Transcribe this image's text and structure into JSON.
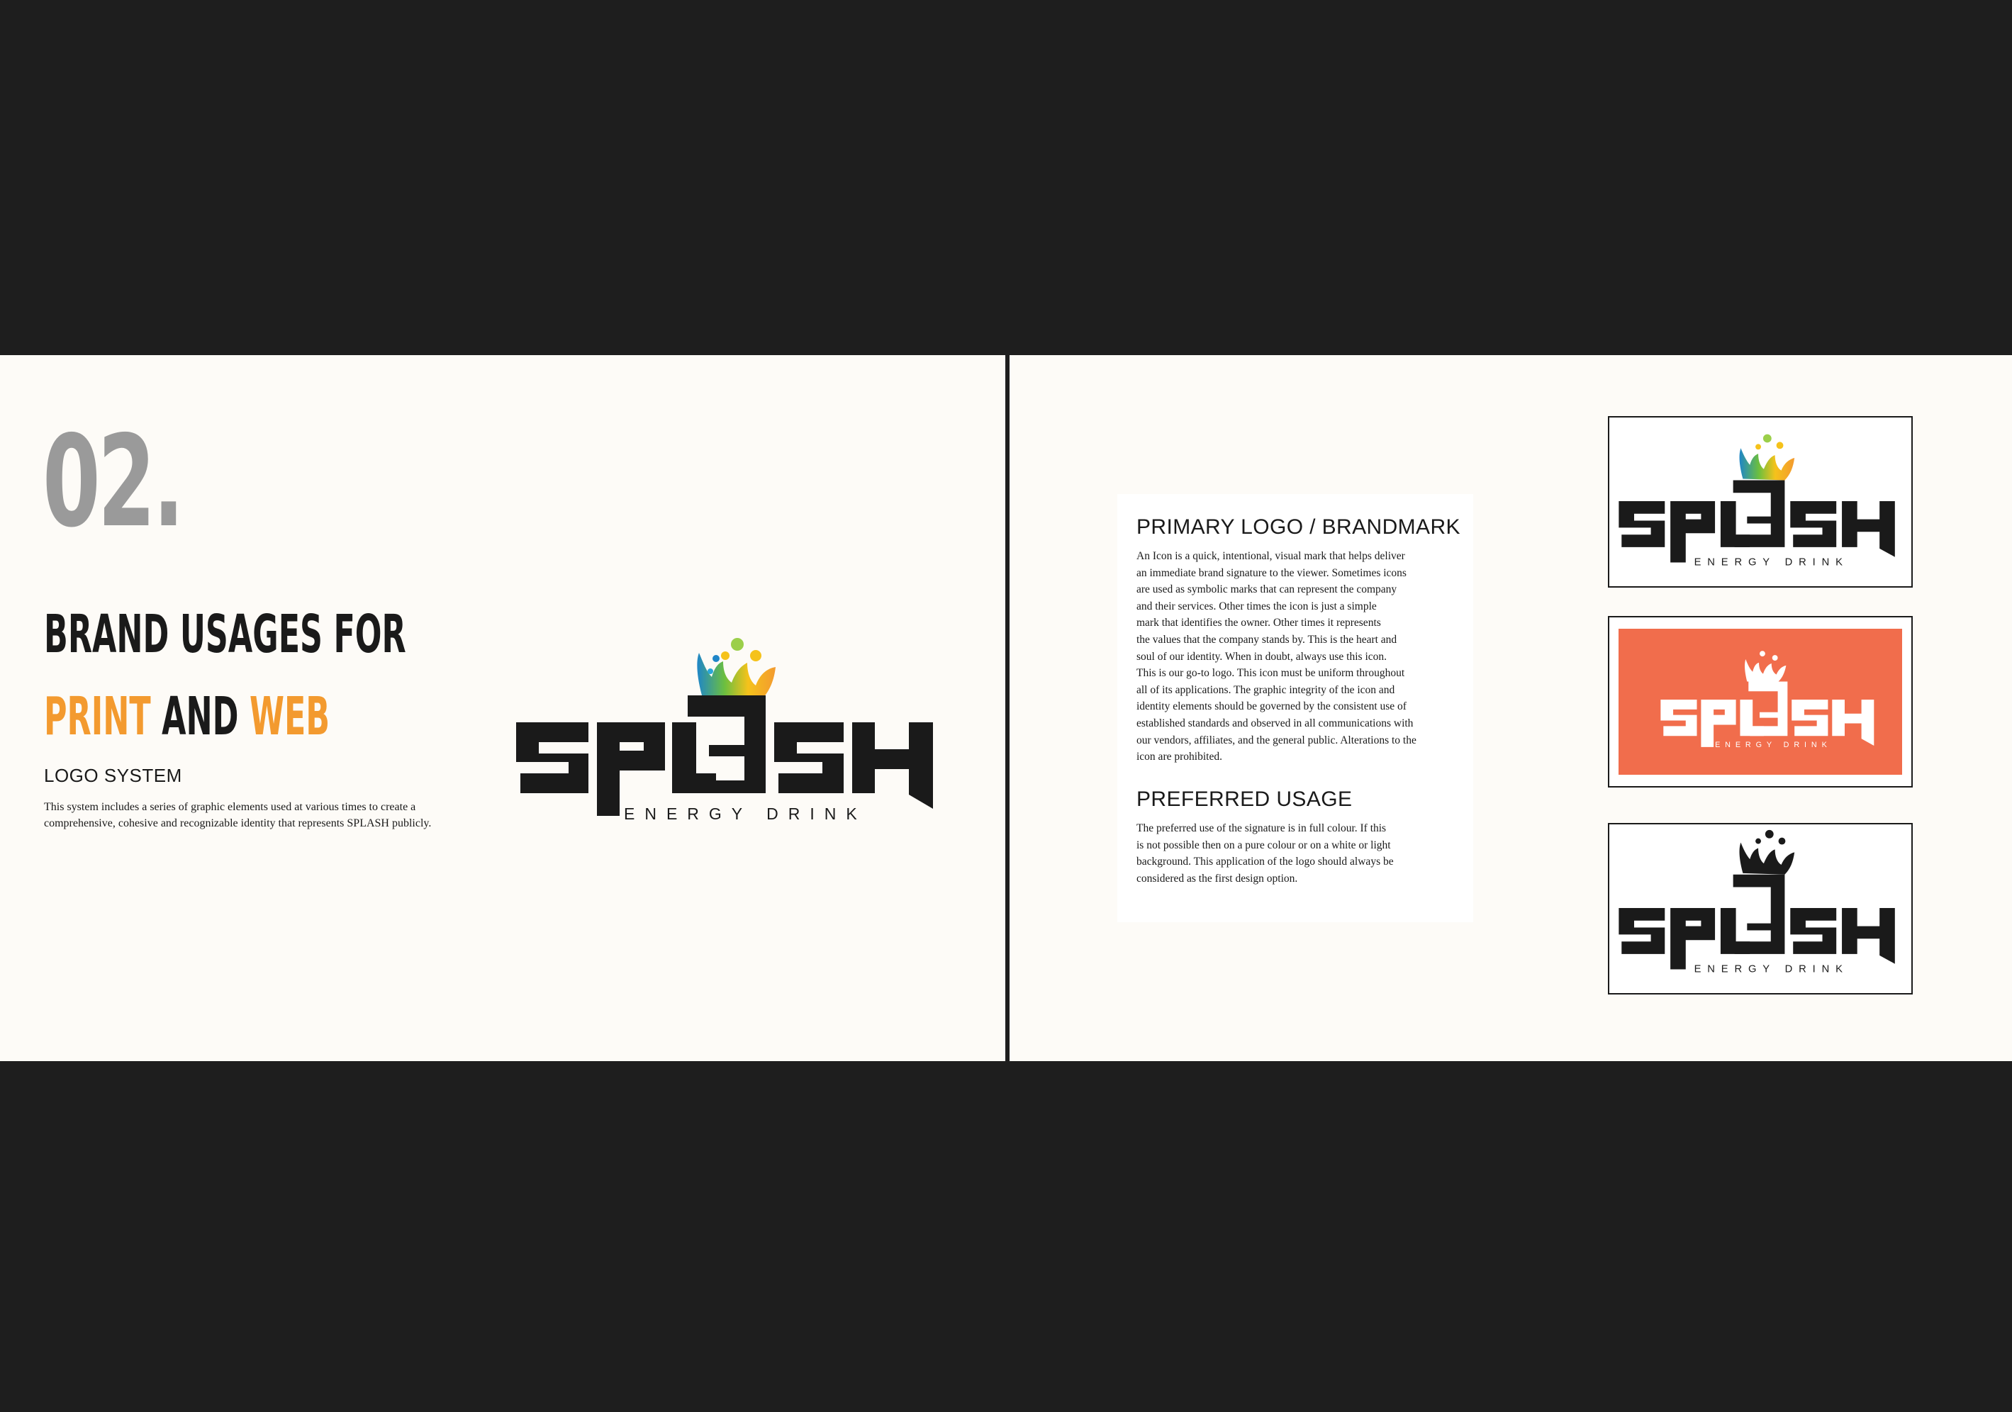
{
  "left_page": {
    "number": "02.",
    "headline_line1": "BRAND USAGES FOR",
    "headline_word_print": "PRINT",
    "headline_word_and": "AND",
    "headline_word_web": "WEB",
    "section_title": "LOGO SYSTEM",
    "section_body": "This system includes a series of graphic elements used at various times to create a comprehensive, cohesive and recognizable identity that represents SPLASH publicly."
  },
  "logo": {
    "wordmark": "SPLASH",
    "tagline": "ENERGY DRINK"
  },
  "right_page": {
    "primary_heading": "PRIMARY LOGO / BRANDMARK",
    "primary_body": "An Icon is a quick, intentional, visual mark that helps deliver\nan immediate brand signature to the viewer. Sometimes icons\nare used as symbolic marks that can represent the company\nand their services. Other times the icon is just a simple\nmark that identifies the owner. Other times it represents\nthe values that the company stands by.  This is the heart and\nsoul of our identity. When in doubt, always use this icon.\nThis is our go-to logo. This icon must be uniform throughout\nall of its applications. The graphic integrity of the icon and\nidentity elements should be governed by the consistent use of\nestablished standards and observed in all communications with\nour vendors, affiliates, and the general public. Alterations to the\nicon are prohibited.",
    "preferred_heading": "PREFERRED USAGE",
    "preferred_body": "The preferred use of the signature is in full colour. If this\nis not possible then on a pure colour or on a white or light\nbackground. This application of the logo should always be\nconsidered as the first design option."
  },
  "colors": {
    "background_dark": "#1e1e1e",
    "page": "#fdfbf7",
    "accent_orange": "#f39a2f",
    "logo_panel_coral": "#f16d4c",
    "number_gray": "#9a9a9a",
    "ink": "#1a1a1a"
  }
}
